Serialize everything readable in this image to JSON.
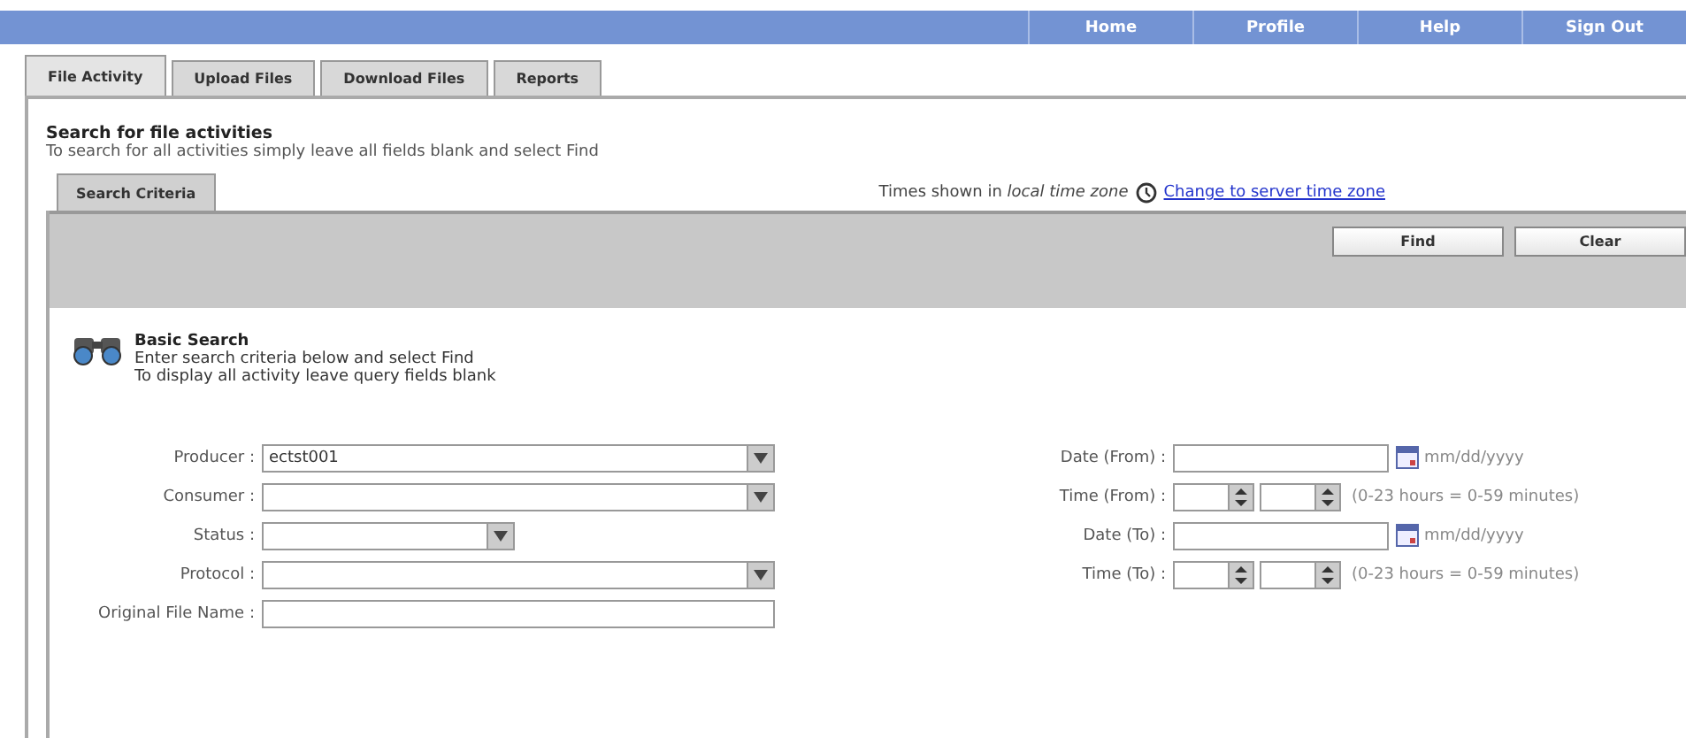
{
  "nav": [
    {
      "label": "Home"
    },
    {
      "label": "Profile"
    },
    {
      "label": "Help"
    },
    {
      "label": "Sign Out"
    }
  ],
  "tabs": [
    {
      "label": "File Activity",
      "selected": true
    },
    {
      "label": "Upload Files",
      "selected": false
    },
    {
      "label": "Download Files",
      "selected": false
    },
    {
      "label": "Reports",
      "selected": false
    }
  ],
  "heading": "Search for file activities",
  "subheading": "To search for all activities simply leave all fields blank and select Find",
  "criteria_tab": {
    "label": "Search Criteria",
    "selected": true
  },
  "timezone_note": "Times shown in *local time zone*",
  "timezone_link": "Change to server time zone",
  "buttons": [
    {
      "label": "Find"
    },
    {
      "label": "Clear"
    }
  ],
  "basic_search": {
    "title": "Basic Search",
    "lines": [
      "Enter search criteria below and select Find",
      "To display all activity leave query fields blank"
    ]
  },
  "left_fields": [
    {
      "label": "Producer :",
      "kind": "select",
      "value": "ectst001"
    },
    {
      "label": "Consumer :",
      "kind": "select"
    },
    {
      "label": "Status :",
      "kind": "shortselect"
    },
    {
      "label": "Protocol :",
      "kind": "select"
    },
    {
      "label": "Original File Name :",
      "kind": "text"
    }
  ],
  "right_fields": [
    {
      "label": "Date (From) :",
      "kind": "date",
      "hint": "mm/dd/yyyy"
    },
    {
      "label": "Time (From) :",
      "kind": "time",
      "hint": "(0-23 hours = 0-59 minutes)"
    },
    {
      "label": "Date (To) :",
      "kind": "date",
      "hint": "mm/dd/yyyy"
    },
    {
      "label": "Time (To) :",
      "kind": "time",
      "hint": "(0-23 hours = 0-59 minutes)"
    }
  ]
}
